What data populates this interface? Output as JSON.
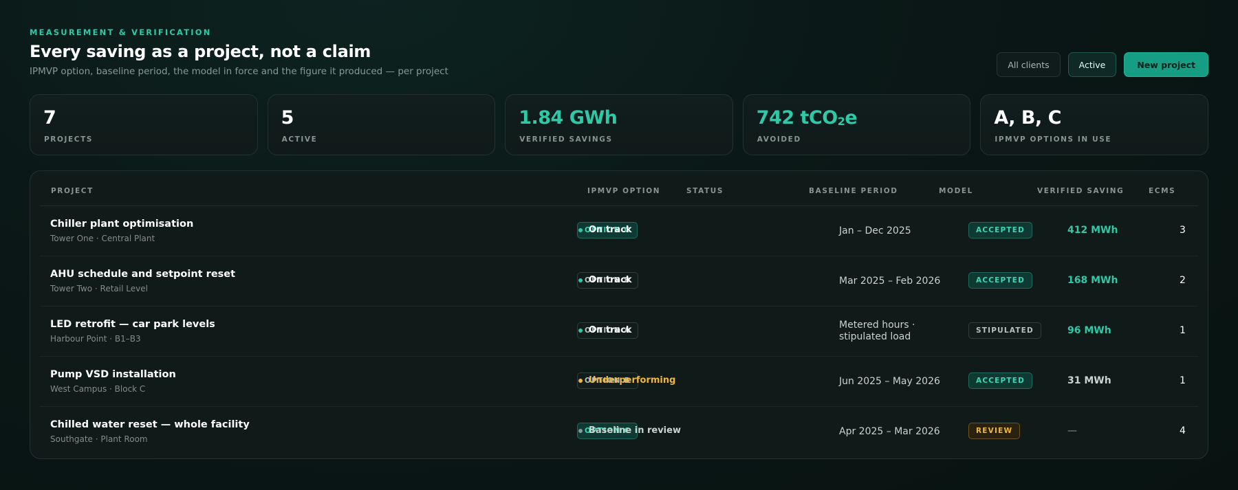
{
  "header": {
    "eyebrow": "MEASUREMENT & VERIFICATION",
    "title": "Every saving as a project, not a claim",
    "subtitle": "IPMVP option, baseline period, the model in force and the figure it produced — per project",
    "buttons": {
      "all_clients": "All clients",
      "active": "Active",
      "new_project": "New project"
    }
  },
  "stats": [
    {
      "value": "7",
      "label": "PROJECTS"
    },
    {
      "value": "5",
      "label": "ACTIVE"
    },
    {
      "value": "1.84 GWh",
      "label": "VERIFIED SAVINGS"
    },
    {
      "value_main": "742 tCO",
      "value_sub": "2",
      "value_tail": "e",
      "label": "AVOIDED"
    },
    {
      "value": "A, B, C",
      "label": "IPMVP OPTIONS IN USE"
    }
  ],
  "table": {
    "columns": [
      "PROJECT",
      "IPMVP OPTION",
      "STATUS",
      "BASELINE PERIOD",
      "MODEL",
      "VERIFIED SAVING",
      "ECMS"
    ],
    "rows": [
      {
        "name": "Chiller plant optimisation",
        "location": "Tower One · Central Plant",
        "option": "OPTION C",
        "status": "On track",
        "baseline_1": "Jan – Dec 2025",
        "baseline_2": "",
        "model": "ACCEPTED",
        "saving": "412 MWh",
        "ecms": "3"
      },
      {
        "name": "AHU schedule and setpoint reset",
        "location": "Tower Two · Retail Level",
        "option": "OPTION B",
        "status": "On track",
        "baseline_1": "Mar 2025 – Feb 2026",
        "baseline_2": "",
        "model": "ACCEPTED",
        "saving": "168 MWh",
        "ecms": "2"
      },
      {
        "name": "LED retrofit — car park levels",
        "location": "Harbour Point · B1–B3",
        "option": "OPTION A",
        "status": "On track",
        "baseline_1": "Metered hours ·",
        "baseline_2": "stipulated load",
        "model": "STIPULATED",
        "saving": "96 MWh",
        "ecms": "1"
      },
      {
        "name": "Pump VSD installation",
        "location": "West Campus · Block C",
        "option": "OPTION B",
        "status": "Underperforming",
        "baseline_1": "Jun 2025 – May 2026",
        "baseline_2": "",
        "model": "ACCEPTED",
        "saving": "31 MWh",
        "ecms": "1"
      },
      {
        "name": "Chilled water reset — whole facility",
        "location": "Southgate · Plant Room",
        "option": "OPTION C",
        "status": "Baseline in review",
        "baseline_1": "Apr 2025 – Mar 2026",
        "baseline_2": "",
        "model": "REVIEW",
        "saving": "—",
        "ecms": "4"
      }
    ]
  },
  "colors": {
    "accent": "#2ec9a7",
    "on_track": "#2ec9a7",
    "underperforming": "#f0b73a",
    "review": "#8a9896",
    "text_white": "#ffffff",
    "text_muted": "#c9d3d1"
  }
}
